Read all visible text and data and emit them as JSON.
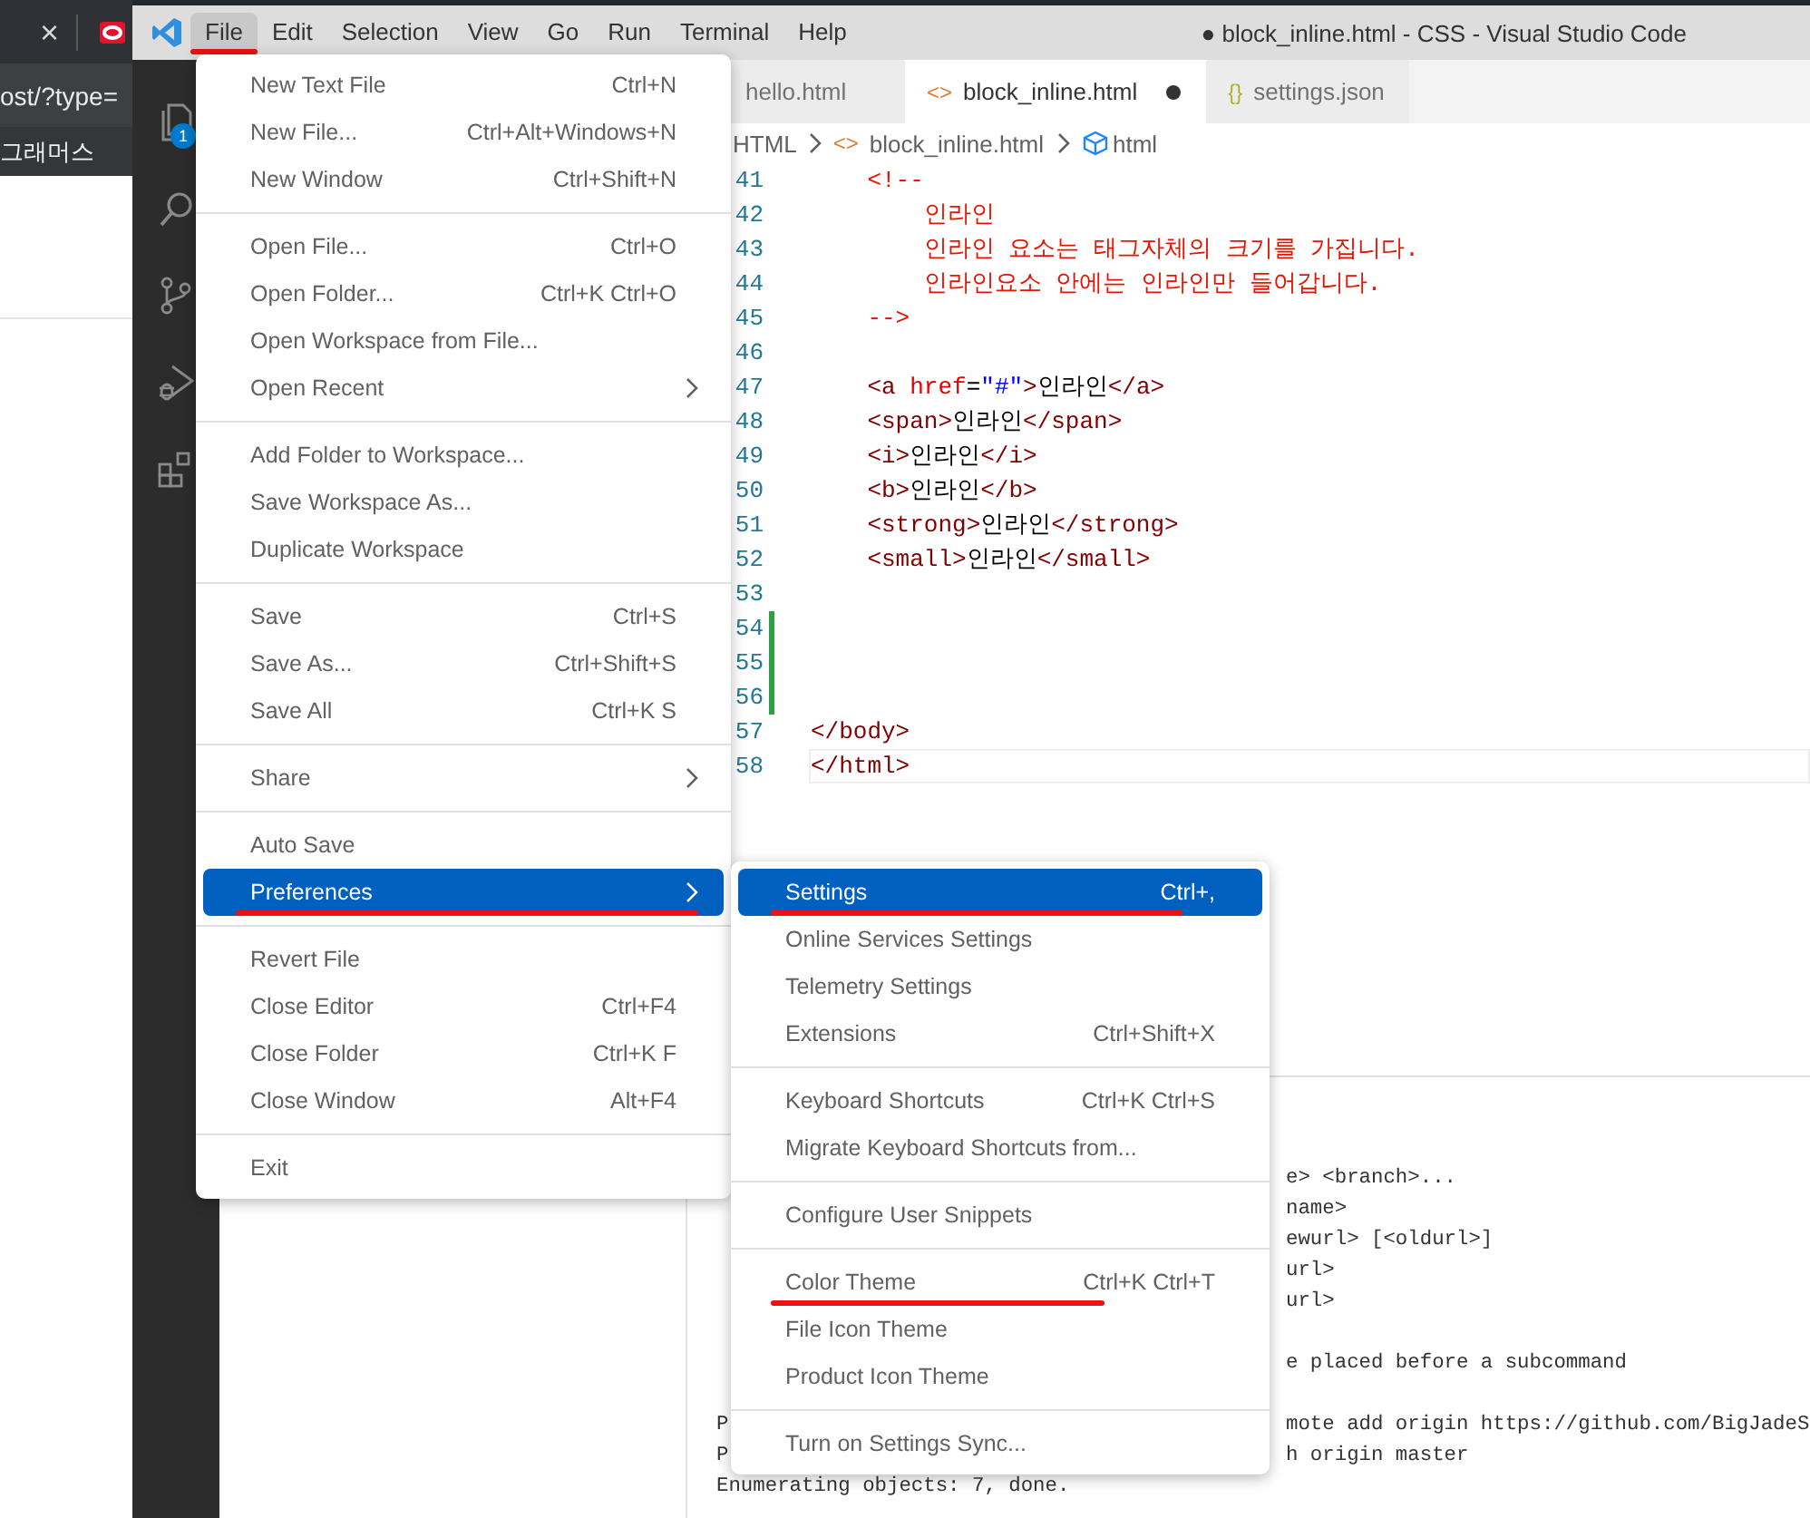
{
  "browser": {
    "close_glyph": "×",
    "address": "ost/?type=",
    "bookmark": "그래머스"
  },
  "window": {
    "title": "● block_inline.html - CSS - Visual Studio Code"
  },
  "menu_bar": [
    {
      "label": "File",
      "selected": true,
      "annotated": true
    },
    {
      "label": "Edit",
      "selected": false,
      "annotated": false
    },
    {
      "label": "Selection",
      "selected": false,
      "annotated": false
    },
    {
      "label": "View",
      "selected": false,
      "annotated": false
    },
    {
      "label": "Go",
      "selected": false,
      "annotated": false
    },
    {
      "label": "Run",
      "selected": false,
      "annotated": false
    },
    {
      "label": "Terminal",
      "selected": false,
      "annotated": false
    },
    {
      "label": "Help",
      "selected": false,
      "annotated": false
    }
  ],
  "activity_bar": {
    "explorer_badge": "1"
  },
  "tabs": [
    {
      "label": "hello.html",
      "selected": false,
      "modified": false
    },
    {
      "icon": "<>",
      "kind": "html",
      "label": "block_inline.html",
      "selected": true,
      "modified": true
    },
    {
      "icon": "{}",
      "kind": "json",
      "label": "settings.json",
      "selected": false,
      "modified": false
    }
  ],
  "breadcrumbs": [
    {
      "kind": "folder",
      "label": "HTML"
    },
    {
      "kind": "file",
      "icon": "<>",
      "label": "block_inline.html"
    },
    {
      "kind": "symbol",
      "label": "html"
    }
  ],
  "code_lines": [
    {
      "number": "41",
      "added": false,
      "current": false,
      "tokens": [
        {
          "t": "    <!--",
          "kind": "comment"
        }
      ]
    },
    {
      "number": "42",
      "added": false,
      "current": false,
      "tokens": [
        {
          "t": "        인라인",
          "kind": "comment"
        }
      ]
    },
    {
      "number": "43",
      "added": false,
      "current": false,
      "tokens": [
        {
          "t": "        인라인 요소는 태그자체의 크기를 가집니다.",
          "kind": "comment"
        }
      ]
    },
    {
      "number": "44",
      "added": false,
      "current": false,
      "tokens": [
        {
          "t": "        인라인요소 안에는 인라인만 들어갑니다.",
          "kind": "comment"
        }
      ]
    },
    {
      "number": "45",
      "added": false,
      "current": false,
      "tokens": [
        {
          "t": "    -->",
          "kind": "comment"
        }
      ]
    },
    {
      "number": "46",
      "added": false,
      "current": false
    },
    {
      "number": "47",
      "added": false,
      "current": false,
      "tokens": [
        {
          "t": "    <a",
          "kind": "tag"
        },
        {
          "t": " href",
          "kind": "attr"
        },
        {
          "t": "=",
          "kind": "text"
        },
        {
          "t": "\"#\"",
          "kind": "string"
        },
        {
          "t": ">",
          "kind": "tag"
        },
        {
          "t": "인라인",
          "kind": "text"
        },
        {
          "t": "</a>",
          "kind": "tag"
        }
      ]
    },
    {
      "number": "48",
      "added": false,
      "current": false,
      "tokens": [
        {
          "t": "    <span>",
          "kind": "tag"
        },
        {
          "t": "인라인",
          "kind": "text"
        },
        {
          "t": "</span>",
          "kind": "tag"
        }
      ]
    },
    {
      "number": "49",
      "added": false,
      "current": false,
      "tokens": [
        {
          "t": "    <i>",
          "kind": "tag"
        },
        {
          "t": "인라인",
          "kind": "text"
        },
        {
          "t": "</i>",
          "kind": "tag"
        }
      ]
    },
    {
      "number": "50",
      "added": false,
      "current": false,
      "tokens": [
        {
          "t": "    <b>",
          "kind": "tag"
        },
        {
          "t": "인라인",
          "kind": "text"
        },
        {
          "t": "</b>",
          "kind": "tag"
        }
      ]
    },
    {
      "number": "51",
      "added": false,
      "current": false,
      "tokens": [
        {
          "t": "    <strong>",
          "kind": "tag"
        },
        {
          "t": "인라인",
          "kind": "text"
        },
        {
          "t": "</strong>",
          "kind": "tag"
        }
      ]
    },
    {
      "number": "52",
      "added": false,
      "current": false,
      "tokens": [
        {
          "t": "    <small>",
          "kind": "tag"
        },
        {
          "t": "인라인",
          "kind": "text"
        },
        {
          "t": "</small>",
          "kind": "tag"
        }
      ]
    },
    {
      "number": "53",
      "added": false,
      "current": false
    },
    {
      "number": "54",
      "added": true,
      "current": false
    },
    {
      "number": "55",
      "added": true,
      "current": false
    },
    {
      "number": "56",
      "added": true,
      "current": false
    },
    {
      "number": "57",
      "added": false,
      "current": false,
      "tokens": [
        {
          "t": "</body>",
          "kind": "tag"
        }
      ]
    },
    {
      "number": "58",
      "added": false,
      "current": true,
      "tokens": [
        {
          "t": "</html>",
          "kind": "tag"
        }
      ]
    }
  ],
  "terminal_lines": [
    {
      "kind": "plain",
      "right": "e> <branch>..."
    },
    {
      "kind": "plain",
      "right": "name>"
    },
    {
      "kind": "plain",
      "right": "ewurl> [<oldurl>]"
    },
    {
      "kind": "plain",
      "right": "url>"
    },
    {
      "kind": "plain",
      "right": "url>"
    },
    {
      "kind": "spaced",
      "right": "e placed before a subcommand"
    },
    {
      "kind": "spaced",
      "left": "P",
      "right": "mote add origin https://github.com/BigJadeS"
    },
    {
      "kind": "plain",
      "left": "P",
      "right": "h origin master"
    },
    {
      "kind": "plain",
      "left": "Enumerating objects: 7, done."
    }
  ],
  "file_menu": [
    [
      {
        "label": "New Text File",
        "shortcut": "Ctrl+N",
        "submenu": false,
        "selected": false,
        "annotated": false
      },
      {
        "label": "New File...",
        "shortcut": "Ctrl+Alt+Windows+N",
        "submenu": false,
        "selected": false,
        "annotated": false
      },
      {
        "label": "New Window",
        "shortcut": "Ctrl+Shift+N",
        "submenu": false,
        "selected": false,
        "annotated": false
      }
    ],
    [
      {
        "label": "Open File...",
        "shortcut": "Ctrl+O",
        "submenu": false,
        "selected": false,
        "annotated": false
      },
      {
        "label": "Open Folder...",
        "shortcut": "Ctrl+K Ctrl+O",
        "submenu": false,
        "selected": false,
        "annotated": false
      },
      {
        "label": "Open Workspace from File...",
        "submenu": false,
        "selected": false,
        "annotated": false
      },
      {
        "label": "Open Recent",
        "submenu": true,
        "selected": false,
        "annotated": false
      }
    ],
    [
      {
        "label": "Add Folder to Workspace...",
        "submenu": false,
        "selected": false,
        "annotated": false
      },
      {
        "label": "Save Workspace As...",
        "submenu": false,
        "selected": false,
        "annotated": false
      },
      {
        "label": "Duplicate Workspace",
        "submenu": false,
        "selected": false,
        "annotated": false
      }
    ],
    [
      {
        "label": "Save",
        "shortcut": "Ctrl+S",
        "submenu": false,
        "selected": false,
        "annotated": false
      },
      {
        "label": "Save As...",
        "shortcut": "Ctrl+Shift+S",
        "submenu": false,
        "selected": false,
        "annotated": false
      },
      {
        "label": "Save All",
        "shortcut": "Ctrl+K S",
        "submenu": false,
        "selected": false,
        "annotated": false
      }
    ],
    [
      {
        "label": "Share",
        "submenu": true,
        "selected": false,
        "annotated": false
      }
    ],
    [
      {
        "label": "Auto Save",
        "submenu": false,
        "selected": false,
        "annotated": false
      },
      {
        "label": "Preferences",
        "submenu": true,
        "selected": true,
        "annotated": true
      }
    ],
    [
      {
        "label": "Revert File",
        "submenu": false,
        "selected": false,
        "annotated": false
      },
      {
        "label": "Close Editor",
        "shortcut": "Ctrl+F4",
        "submenu": false,
        "selected": false,
        "annotated": false
      },
      {
        "label": "Close Folder",
        "shortcut": "Ctrl+K F",
        "submenu": false,
        "selected": false,
        "annotated": false
      },
      {
        "label": "Close Window",
        "shortcut": "Alt+F4",
        "submenu": false,
        "selected": false,
        "annotated": false
      }
    ],
    [
      {
        "label": "Exit",
        "submenu": false,
        "selected": false,
        "annotated": false
      }
    ]
  ],
  "preferences_submenu": [
    [
      {
        "label": "Settings",
        "shortcut": "Ctrl+,",
        "submenu": false,
        "selected": true,
        "annotated": true
      },
      {
        "label": "Online Services Settings",
        "submenu": false,
        "selected": false,
        "annotated": false
      },
      {
        "label": "Telemetry Settings",
        "submenu": false,
        "selected": false,
        "annotated": false
      },
      {
        "label": "Extensions",
        "shortcut": "Ctrl+Shift+X",
        "submenu": false,
        "selected": false,
        "annotated": false
      }
    ],
    [
      {
        "label": "Keyboard Shortcuts",
        "shortcut": "Ctrl+K Ctrl+S",
        "submenu": false,
        "selected": false,
        "annotated": false
      },
      {
        "label": "Migrate Keyboard Shortcuts from...",
        "submenu": false,
        "selected": false,
        "annotated": false
      }
    ],
    [
      {
        "label": "Configure User Snippets",
        "submenu": false,
        "selected": false,
        "annotated": false
      }
    ],
    [
      {
        "label": "Color Theme",
        "shortcut": "Ctrl+K Ctrl+T",
        "submenu": false,
        "selected": false,
        "annotated": true
      },
      {
        "label": "File Icon Theme",
        "submenu": false,
        "selected": false,
        "annotated": false
      },
      {
        "label": "Product Icon Theme",
        "submenu": false,
        "selected": false,
        "annotated": false
      }
    ],
    [
      {
        "label": "Turn on Settings Sync...",
        "submenu": false,
        "selected": false,
        "annotated": false
      }
    ]
  ]
}
